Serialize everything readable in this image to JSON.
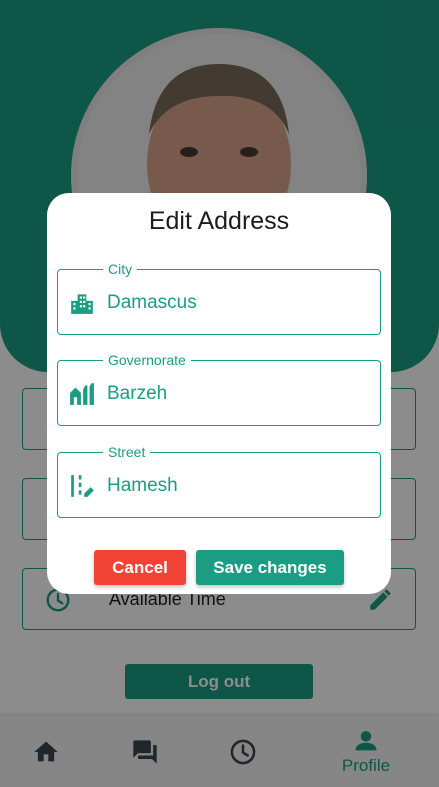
{
  "profile": {
    "info_rows": [
      {
        "label": "",
        "icon": "location-icon"
      },
      {
        "label": "",
        "icon": "phone-icon"
      },
      {
        "label": "Available Time",
        "icon": "clock-icon"
      }
    ],
    "logout_label": "Log out"
  },
  "nav": {
    "items": [
      {
        "icon": "home-icon",
        "label": ""
      },
      {
        "icon": "chat-icon",
        "label": ""
      },
      {
        "icon": "clock-icon",
        "label": ""
      },
      {
        "icon": "person-icon",
        "label": "Profile"
      }
    ]
  },
  "dialog": {
    "title": "Edit Address",
    "fields": [
      {
        "legend": "City",
        "value": "Damascus",
        "icon": "city-buildings-icon"
      },
      {
        "legend": "Governorate",
        "value": "Barzeh",
        "icon": "houses-icon"
      },
      {
        "legend": "Street",
        "value": "Hamesh",
        "icon": "road-edit-icon"
      }
    ],
    "cancel_label": "Cancel",
    "save_label": "Save changes"
  },
  "colors": {
    "accent": "#1b9d83",
    "danger": "#f24236",
    "overlay": "rgba(0,0,0,0.45)"
  }
}
